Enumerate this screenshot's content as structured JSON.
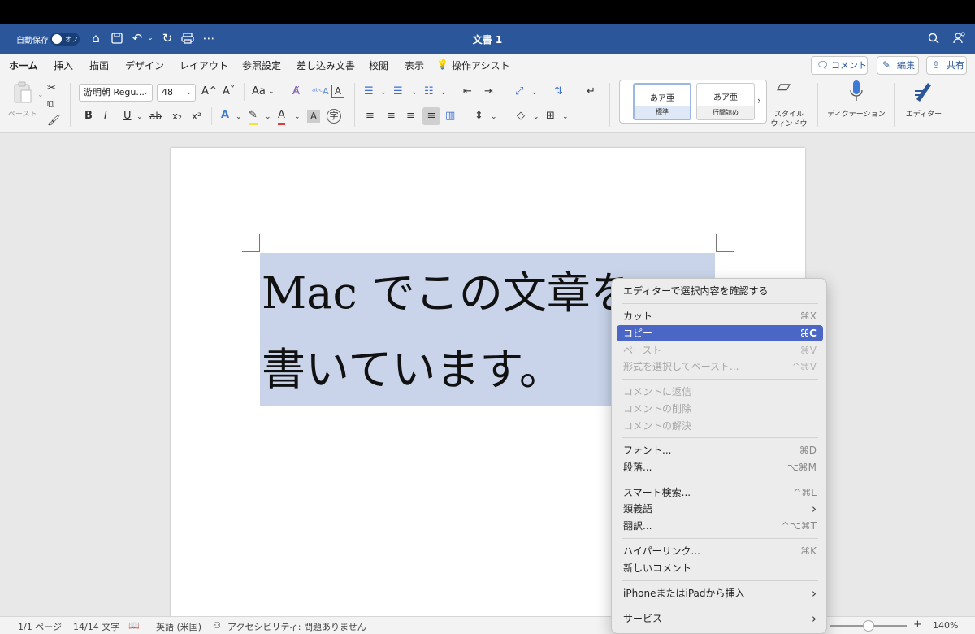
{
  "titlebar": {
    "autosave_label": "自動保存",
    "autosave_state": "オフ",
    "doc_title": "文書 1",
    "icons": [
      "home-icon",
      "save-icon",
      "undo-icon",
      "redo-icon",
      "print-icon",
      "more-icon",
      "search-icon",
      "share-people-icon"
    ]
  },
  "tabs": [
    "ホーム",
    "挿入",
    "描画",
    "デザイン",
    "レイアウト",
    "参照設定",
    "差し込み文書",
    "校閲",
    "表示",
    "操作アシスト"
  ],
  "tab_buttons": {
    "comment": "コメント",
    "edit": "編集",
    "share": "共有"
  },
  "ribbon": {
    "paste_label": "ペースト",
    "font_name": "游明朝 Regu...",
    "font_size": "48",
    "grow_font": "A^",
    "shrink_font": "Aˇ",
    "change_case": "Aa",
    "bold": "B",
    "italic": "I",
    "underline": "U",
    "strikethrough": "ab",
    "subscript": "x₂",
    "superscript": "x²",
    "styles": [
      {
        "preview": "あア亜",
        "name": "標準"
      },
      {
        "preview": "あア亜",
        "name": "行間詰め"
      }
    ],
    "style_window_label_1": "スタイル",
    "style_window_label_2": "ウィンドウ",
    "dictation_label": "ディクテーション",
    "editor_label": "エディター"
  },
  "document": {
    "line1": "Mac でこの文章を",
    "line2": "書いています。"
  },
  "context_menu": {
    "items": [
      {
        "label": "エディターで選択内容を確認する",
        "shortcut": ""
      },
      {
        "label": "カット",
        "shortcut": "⌘X"
      },
      {
        "label": "コピー",
        "shortcut": "⌘C"
      },
      {
        "label": "ペースト",
        "shortcut": "⌘V"
      },
      {
        "label": "形式を選択してペースト...",
        "shortcut": "^⌘V"
      },
      {
        "label": "コメントに返信",
        "shortcut": ""
      },
      {
        "label": "コメントの削除",
        "shortcut": ""
      },
      {
        "label": "コメントの解決",
        "shortcut": ""
      },
      {
        "label": "フォント...",
        "shortcut": "⌘D"
      },
      {
        "label": "段落...",
        "shortcut": "⌥⌘M"
      },
      {
        "label": "スマート検索...",
        "shortcut": "^⌘L"
      },
      {
        "label": "類義語",
        "shortcut": "›"
      },
      {
        "label": "翻訳...",
        "shortcut": "^⌥⌘T"
      },
      {
        "label": "ハイパーリンク...",
        "shortcut": "⌘K"
      },
      {
        "label": "新しいコメント",
        "shortcut": ""
      },
      {
        "label": "iPhoneまたはiPadから挿入",
        "shortcut": "›"
      },
      {
        "label": "サービス",
        "shortcut": "›"
      }
    ]
  },
  "status": {
    "page": "1/1 ページ",
    "words": "14/14 文字",
    "language": "英語 (米国)",
    "accessibility": "アクセシビリティ: 問題ありません",
    "zoom": "140%",
    "zoom_level": 0.5
  },
  "colors": {
    "title_bar": "#2b579a",
    "selection": "#c9d4ea",
    "menu_highlight": "#4a67c6"
  }
}
